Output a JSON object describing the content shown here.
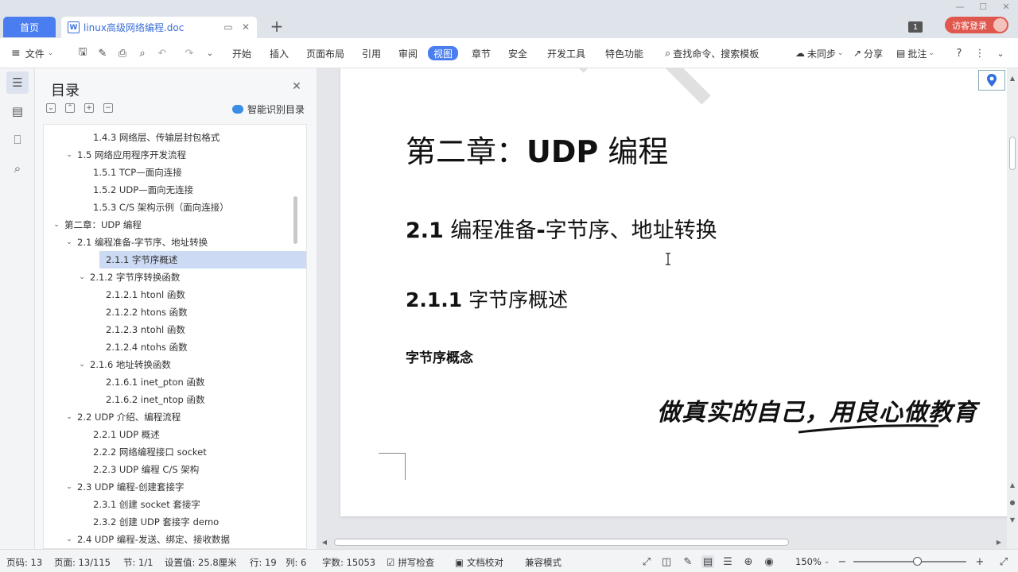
{
  "titlebar": {
    "home_tab": "首页",
    "doc_icon_letter": "W",
    "doc_tab_title": "linux高级网络编程.doc",
    "add_tab": "+",
    "badge": "1",
    "login_label": "访客登录"
  },
  "ribbon": {
    "file_menu": "文件",
    "tabs": [
      "开始",
      "插入",
      "页面布局",
      "引用",
      "审阅",
      "视图",
      "章节",
      "安全",
      "开发工具",
      "特色功能"
    ],
    "active_tab": "视图",
    "search": "查找命令、搜索模板",
    "sync": "未同步",
    "share": "分享",
    "comment": "批注"
  },
  "toc": {
    "title": "目录",
    "smart_label": "智能识别目录",
    "items": [
      {
        "text": "1.4.3 网络层、传输层封包格式",
        "level": 3,
        "caret": ""
      },
      {
        "text": "1.5 网络应用程序开发流程",
        "level": 2,
        "caret": "v"
      },
      {
        "text": "1.5.1 TCP—面向连接",
        "level": 3,
        "caret": ""
      },
      {
        "text": "1.5.2 UDP—面向无连接",
        "level": 3,
        "caret": ""
      },
      {
        "text": "1.5.3 C/S 架构示例（面向连接）",
        "level": 3,
        "caret": ""
      },
      {
        "text": "第二章：UDP 编程",
        "level": 1,
        "caret": "v"
      },
      {
        "text": "2.1 编程准备-字节序、地址转换",
        "level": 2,
        "caret": "v"
      },
      {
        "text": "2.1.1 字节序概述",
        "level": 3,
        "caret": "",
        "selected": true
      },
      {
        "text": "2.1.2  字节序转换函数",
        "level": 3,
        "caret": "v"
      },
      {
        "text": "2.1.2.1 htonl 函数",
        "level": 4,
        "caret": ""
      },
      {
        "text": "2.1.2.2 htons 函数",
        "level": 4,
        "caret": ""
      },
      {
        "text": "2.1.2.3 ntohl 函数",
        "level": 4,
        "caret": ""
      },
      {
        "text": "2.1.2.4 ntohs 函数",
        "level": 4,
        "caret": ""
      },
      {
        "text": "2.1.6 地址转换函数",
        "level": 3,
        "caret": "v"
      },
      {
        "text": "2.1.6.1 inet_pton 函数",
        "level": 4,
        "caret": ""
      },
      {
        "text": "2.1.6.2 inet_ntop 函数",
        "level": 4,
        "caret": ""
      },
      {
        "text": "2.2 UDP 介绍、编程流程",
        "level": 2,
        "caret": "v"
      },
      {
        "text": "2.2.1 UDP 概述",
        "level": 3,
        "caret": ""
      },
      {
        "text": "2.2.2 网络编程接口 socket",
        "level": 3,
        "caret": ""
      },
      {
        "text": "2.2.3 UDP 编程 C/S 架构",
        "level": 3,
        "caret": ""
      },
      {
        "text": "2.3 UDP 编程-创建套接字",
        "level": 2,
        "caret": "v"
      },
      {
        "text": "2.3.1 创建 socket 套接字",
        "level": 3,
        "caret": ""
      },
      {
        "text": "2.3.2 创建 UDP 套接字 demo",
        "level": 3,
        "caret": ""
      },
      {
        "text": "2.4 UDP 编程-发送、绑定、接收数据",
        "level": 2,
        "caret": "v"
      }
    ]
  },
  "document": {
    "chapter_title": "第二章：",
    "chapter_title_bold": "UDP",
    "chapter_title_tail": " 编程",
    "section_num": "2.1",
    "section_title": " 编程准备",
    "section_title_bold": "-",
    "section_title_tail": "字节序、地址转换",
    "subsection_num": "2.1.1",
    "subsection_title": " 字节序概述",
    "concept": "字节序概念",
    "slogan": "做真实的自己，用良心做教育"
  },
  "statusbar": {
    "page_num": "页码: 13",
    "pages": "页面: 13/115",
    "section": "节: 1/1",
    "setting": "设置值: 25.8厘米",
    "line": "行: 19",
    "col": "列: 6",
    "words": "字数: 15053",
    "spellcheck": "拼写检查",
    "proofread": "文档校对",
    "compat": "兼容模式",
    "zoom": "150%"
  }
}
